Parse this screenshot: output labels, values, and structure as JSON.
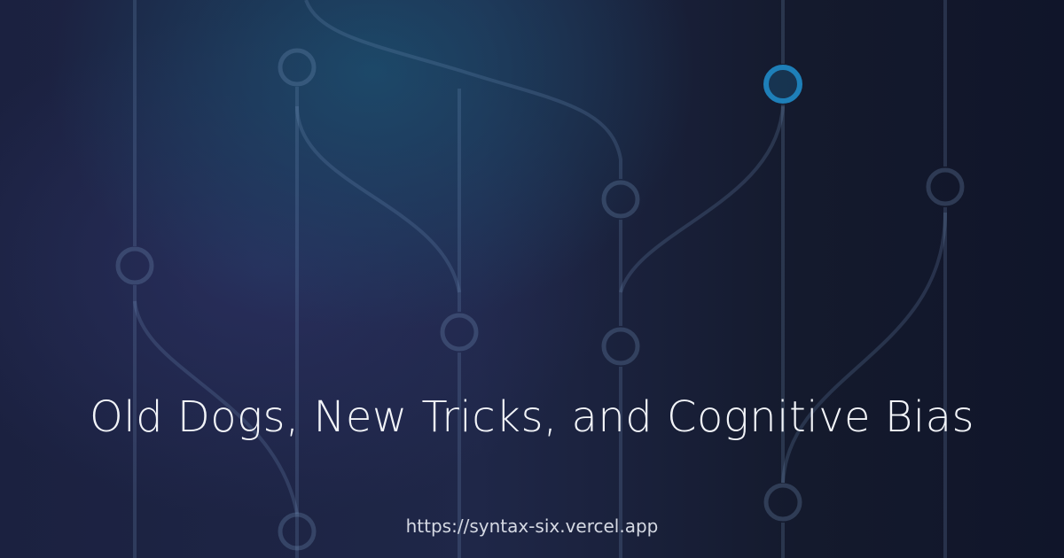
{
  "card": {
    "title": "Old Dogs, New Tricks, and Cognitive Bias",
    "url": "https://syntax-six.vercel.app"
  },
  "decoration": {
    "icon": "git-branch-graph-icon",
    "accent_color": "#1e7fb8"
  }
}
